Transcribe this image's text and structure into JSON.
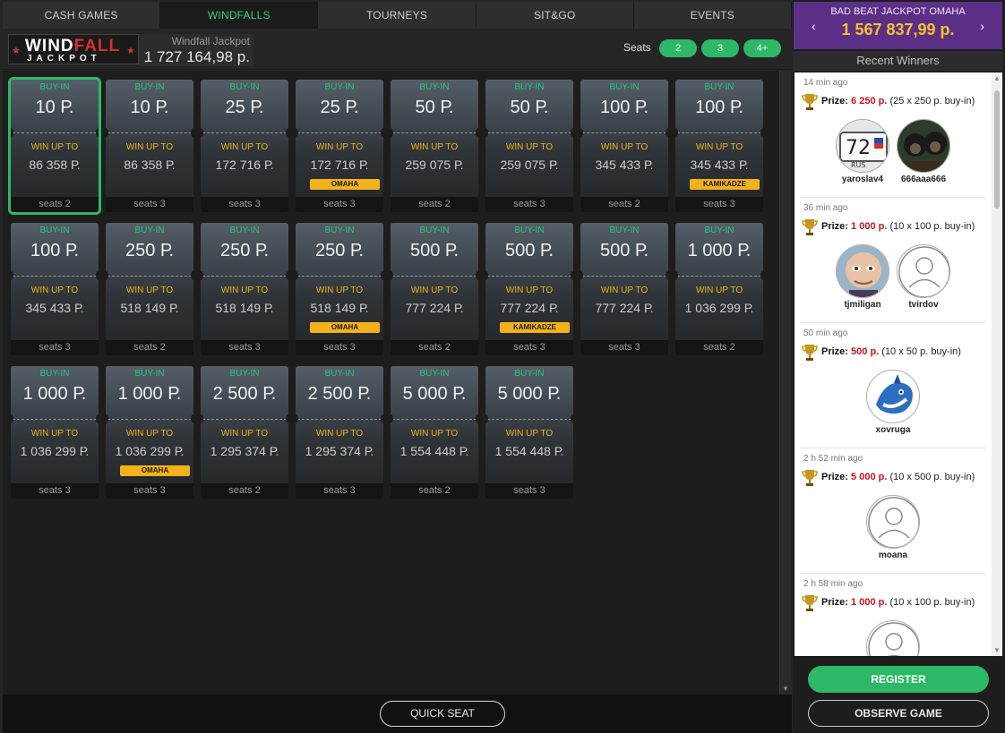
{
  "tabs": [
    "CASH GAMES",
    "WINDFALLS",
    "TOURNEYS",
    "SIT&GO",
    "EVENTS"
  ],
  "active_tab": "WINDFALLS",
  "jackpot": {
    "logo_line1_a": "WIND",
    "logo_line1_b": "FALL",
    "logo_line2": "JACKPOT",
    "label": "Windfall Jackpot",
    "amount": "1 727 164,98 р."
  },
  "seats_filter": {
    "label": "Seats",
    "options": [
      "2",
      "3",
      "4+"
    ]
  },
  "card_labels": {
    "buyin": "BUY-IN",
    "win": "WIN UP TO"
  },
  "cards": [
    {
      "buyin": "10 Р.",
      "win": "86 358 Р.",
      "seats": "seats 2",
      "badge": "",
      "selected": true
    },
    {
      "buyin": "10 Р.",
      "win": "86 358 Р.",
      "seats": "seats 3",
      "badge": ""
    },
    {
      "buyin": "25 Р.",
      "win": "172 716 Р.",
      "seats": "seats 3",
      "badge": ""
    },
    {
      "buyin": "25 Р.",
      "win": "172 716 Р.",
      "seats": "seats 3",
      "badge": "OMAHA"
    },
    {
      "buyin": "50 Р.",
      "win": "259 075 Р.",
      "seats": "seats 2",
      "badge": ""
    },
    {
      "buyin": "50 Р.",
      "win": "259 075 Р.",
      "seats": "seats 3",
      "badge": ""
    },
    {
      "buyin": "100 Р.",
      "win": "345 433 Р.",
      "seats": "seats 2",
      "badge": ""
    },
    {
      "buyin": "100 Р.",
      "win": "345 433 Р.",
      "seats": "seats 3",
      "badge": "KAMIKADZE"
    },
    {
      "buyin": "100 Р.",
      "win": "345 433 Р.",
      "seats": "seats 3",
      "badge": ""
    },
    {
      "buyin": "250 Р.",
      "win": "518 149 Р.",
      "seats": "seats 2",
      "badge": ""
    },
    {
      "buyin": "250 Р.",
      "win": "518 149 Р.",
      "seats": "seats 3",
      "badge": ""
    },
    {
      "buyin": "250 Р.",
      "win": "518 149 Р.",
      "seats": "seats 3",
      "badge": "OMAHA"
    },
    {
      "buyin": "500 Р.",
      "win": "777 224 Р.",
      "seats": "seats 2",
      "badge": ""
    },
    {
      "buyin": "500 Р.",
      "win": "777 224 Р.",
      "seats": "seats 3",
      "badge": "KAMIKADZE"
    },
    {
      "buyin": "500 Р.",
      "win": "777 224 Р.",
      "seats": "seats 3",
      "badge": ""
    },
    {
      "buyin": "1 000 Р.",
      "win": "1 036 299 Р.",
      "seats": "seats 2",
      "badge": ""
    },
    {
      "buyin": "1 000 Р.",
      "win": "1 036 299 Р.",
      "seats": "seats 3",
      "badge": ""
    },
    {
      "buyin": "1 000 Р.",
      "win": "1 036 299 Р.",
      "seats": "seats 3",
      "badge": "OMAHA"
    },
    {
      "buyin": "2 500 Р.",
      "win": "1 295 374 Р.",
      "seats": "seats 2",
      "badge": ""
    },
    {
      "buyin": "2 500 Р.",
      "win": "1 295 374 Р.",
      "seats": "seats 3",
      "badge": ""
    },
    {
      "buyin": "5 000 Р.",
      "win": "1 554 448 Р.",
      "seats": "seats 2",
      "badge": ""
    },
    {
      "buyin": "5 000 Р.",
      "win": "1 554 448 Р.",
      "seats": "seats 3",
      "badge": ""
    }
  ],
  "bad_beat": {
    "title": "BAD BEAT JACKPOT OMAHA",
    "amount": "1 567 837,99 р.",
    "prev": "‹",
    "next": "›"
  },
  "recent_winners": {
    "title": "Recent Winners",
    "prize_label": "Prize:",
    "items": [
      {
        "ago": "14 min ago",
        "amount": "6 250 р.",
        "detail": "(25 x 250 р. buy-in)",
        "players": [
          {
            "name": "yaroslav4",
            "avatar": "plate"
          },
          {
            "name": "666aaa666",
            "avatar": "monkeys"
          }
        ]
      },
      {
        "ago": "36 min ago",
        "amount": "1 000 р.",
        "detail": "(10 x 100 р. buy-in)",
        "players": [
          {
            "name": "tjmiligan",
            "avatar": "face"
          },
          {
            "name": "tvirdov",
            "avatar": "default"
          }
        ]
      },
      {
        "ago": "50 min ago",
        "amount": "500 р.",
        "detail": "(10 x 50 р. buy-in)",
        "players": [
          {
            "name": "xovruga",
            "avatar": "shark"
          }
        ]
      },
      {
        "ago": "2 h 52 min ago",
        "amount": "5 000 р.",
        "detail": "(10 x 500 р. buy-in)",
        "players": [
          {
            "name": "moana",
            "avatar": "default"
          }
        ]
      },
      {
        "ago": "2 h 58 min ago",
        "amount": "1 000 р.",
        "detail": "(10 x 100 р. buy-in)",
        "players": [
          {
            "name": "",
            "avatar": "default"
          }
        ]
      }
    ]
  },
  "buttons": {
    "quick_seat": "QUICK SEAT",
    "register": "REGISTER",
    "observe": "OBSERVE GAME"
  },
  "colors": {
    "accent_green": "#2db867",
    "buyin_label": "#26c77b",
    "win_label": "#f3b21a",
    "bad_beat_bg": "#5b2f86",
    "bad_beat_amount": "#f6c12e",
    "prize_amount": "#c0161b"
  }
}
